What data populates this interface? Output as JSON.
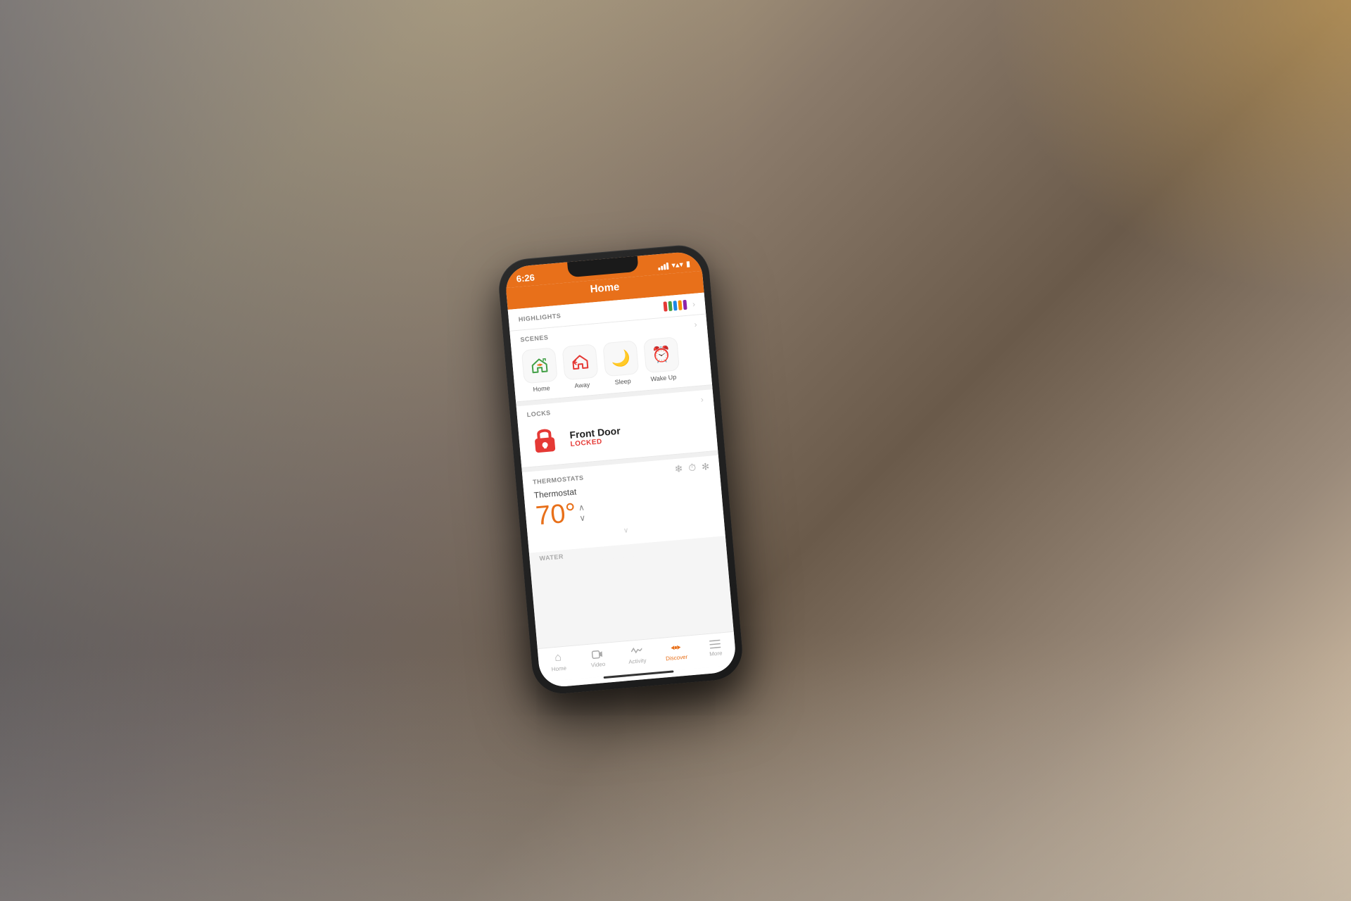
{
  "background": {
    "description": "Person holding phone outdoors, blurred background"
  },
  "phone": {
    "status_bar": {
      "time": "6:26",
      "signal_label": "signal",
      "wifi_label": "wifi",
      "battery_label": "battery"
    },
    "header": {
      "title": "Home"
    },
    "sections": {
      "highlights": {
        "label": "HIGHLIGHTS",
        "chevron": "›",
        "colors": [
          "#e53935",
          "#43a047",
          "#1e88e5",
          "#fb8c00",
          "#8e24aa"
        ]
      },
      "scenes": {
        "label": "SCENES",
        "chevron": "›",
        "items": [
          {
            "name": "Home",
            "emoji": "🏠",
            "color": "#43a047"
          },
          {
            "name": "Away",
            "emoji": "🔄",
            "color": "#e53935"
          },
          {
            "name": "Sleep",
            "emoji": "🌙",
            "color": "#3949ab"
          },
          {
            "name": "Wake Up",
            "emoji": "⏰",
            "color": "#fb8c00"
          }
        ]
      },
      "locks": {
        "label": "LOCKS",
        "chevron": "›",
        "device_name": "Front Door",
        "status": "LOCKED",
        "status_color": "#e53935"
      },
      "thermostats": {
        "label": "THERMOSTATS",
        "device_name": "Thermostat",
        "temperature": "70°",
        "controls": [
          "❄",
          "⏱",
          "✦"
        ]
      },
      "water": {
        "label": "WATER"
      }
    },
    "bottom_nav": {
      "items": [
        {
          "id": "home",
          "label": "Home",
          "icon": "⌂",
          "active": false
        },
        {
          "id": "video",
          "label": "Video",
          "icon": "◻",
          "active": false
        },
        {
          "id": "activity",
          "label": "Activity",
          "icon": "∿",
          "active": false
        },
        {
          "id": "discover",
          "label": "Discover",
          "icon": "⇌",
          "active": true
        },
        {
          "id": "more",
          "label": "More",
          "icon": "≡",
          "active": false
        }
      ]
    }
  }
}
